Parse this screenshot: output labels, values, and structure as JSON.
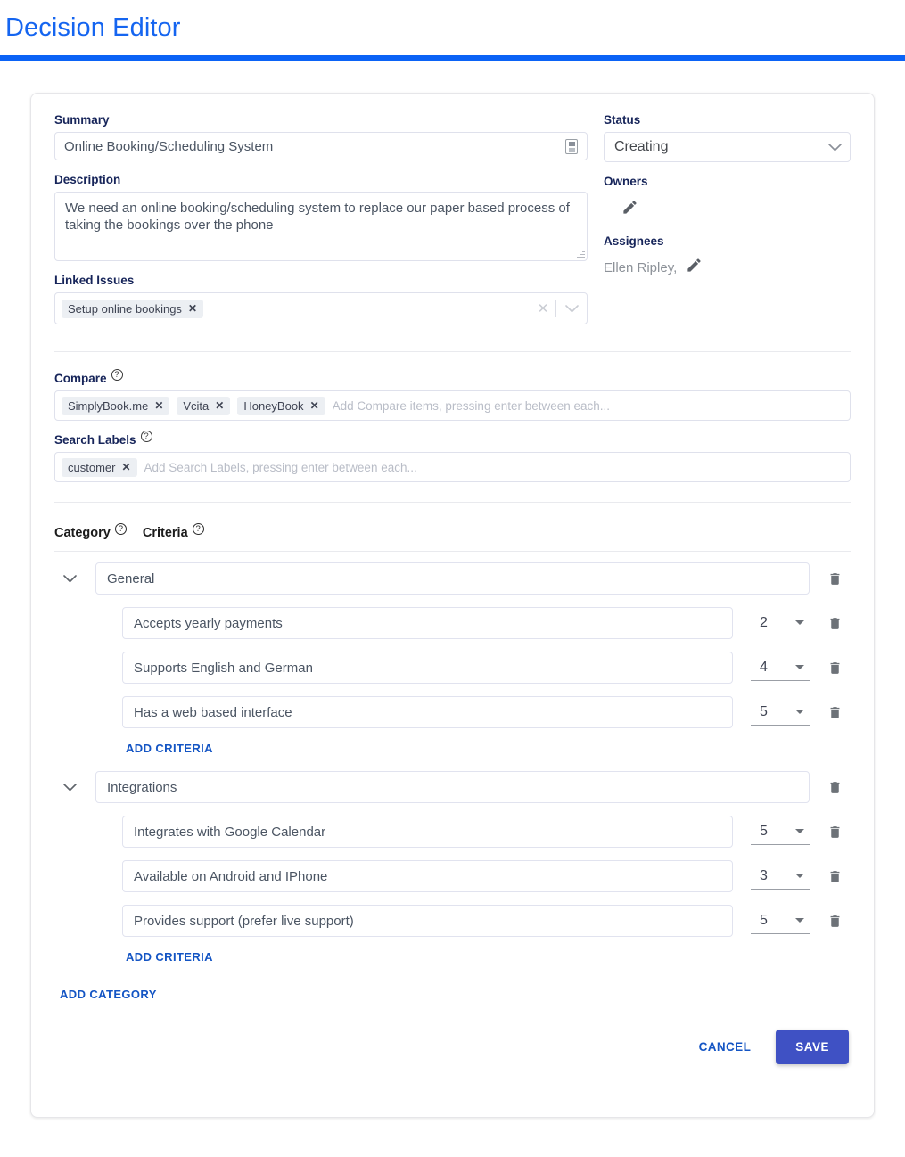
{
  "header": {
    "title": "Decision Editor",
    "accent_color": "#0b63f6"
  },
  "form": {
    "summary": {
      "label": "Summary",
      "value": "Online Booking/Scheduling System",
      "icon": "save-document-icon"
    },
    "description": {
      "label": "Description",
      "value": "We need an online booking/scheduling system to replace our paper based process of taking the bookings over the phone"
    },
    "linked_issues": {
      "label": "Linked Issues",
      "chips": [
        "Setup online bookings"
      ],
      "placeholder": ""
    },
    "status": {
      "label": "Status",
      "value": "Creating"
    },
    "owners": {
      "label": "Owners",
      "value": ""
    },
    "assignees": {
      "label": "Assignees",
      "value": "Ellen Ripley,"
    }
  },
  "compare": {
    "label": "Compare",
    "chips": [
      "SimplyBook.me",
      "Vcita",
      "HoneyBook"
    ],
    "placeholder": "Add Compare items, pressing enter between each..."
  },
  "search_labels": {
    "label": "Search Labels",
    "chips": [
      "customer"
    ],
    "placeholder": "Add Search Labels, pressing enter between each..."
  },
  "criteria_section": {
    "category_label": "Category",
    "criteria_label": "Criteria",
    "add_category_label": "ADD CATEGORY",
    "add_criteria_label": "ADD CRITERIA",
    "categories": [
      {
        "name": "General",
        "criteria": [
          {
            "name": "Accepts yearly payments",
            "score": "2"
          },
          {
            "name": "Supports English and German",
            "score": "4"
          },
          {
            "name": "Has a web based interface",
            "score": "5"
          }
        ]
      },
      {
        "name": "Integrations",
        "criteria": [
          {
            "name": "Integrates with Google Calendar",
            "score": "5"
          },
          {
            "name": "Available on Android and IPhone",
            "score": "3"
          },
          {
            "name": "Provides support (prefer live support)",
            "score": "5"
          }
        ]
      }
    ]
  },
  "footer": {
    "cancel_label": "CANCEL",
    "save_label": "SAVE",
    "save_color": "#3f51c4"
  }
}
